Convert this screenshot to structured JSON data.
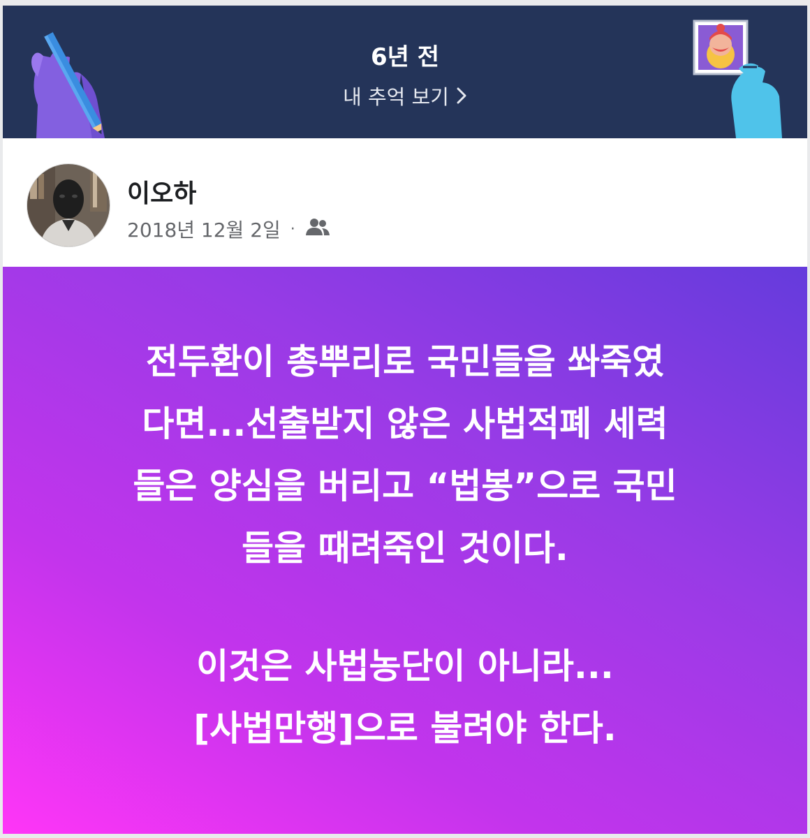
{
  "memory": {
    "title": "6년 전",
    "link_label": "내 추억 보기"
  },
  "post": {
    "author": "이오하",
    "date": "2018년 12월 2일",
    "separator": "·",
    "audience_icon": "friends-icon",
    "paragraphs": [
      {
        "lines": [
          "전두환이 총뿌리로 국민들을 쏴죽였",
          "다면...선출받지 않은 사법적폐 세력",
          "들은 양심을 버리고 “법봉”으로 국민",
          "들을 때려죽인 것이다."
        ]
      },
      {
        "lines": [
          "이것은 사법농단이 아니라...",
          "[사법만행]으로 불려야 한다."
        ]
      }
    ]
  },
  "colors": {
    "header_bg": "#243459",
    "gradient_start": "#ff35f7",
    "gradient_end": "#653bdc",
    "meta_text": "#65676b"
  }
}
